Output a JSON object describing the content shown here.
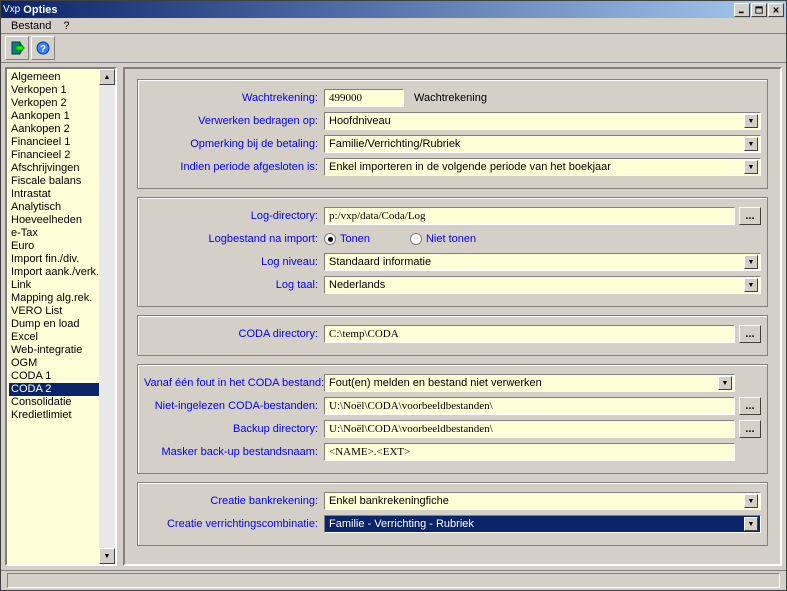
{
  "titlebar": {
    "vxp": "Vxp",
    "title": "Opties"
  },
  "menu": {
    "bestand": "Bestand",
    "help": "?"
  },
  "sidebar": {
    "items": [
      "Algemeen",
      "Verkopen 1",
      "Verkopen 2",
      "Aankopen 1",
      "Aankopen 2",
      "Financieel 1",
      "Financieel 2",
      "Afschrijvingen",
      "Fiscale balans",
      "Intrastat",
      "Analytisch",
      "Hoeveelheden",
      "e-Tax",
      "Euro",
      "Import fin./div.",
      "Import aank./verk.",
      "Link",
      "Mapping alg.rek.",
      "VERO List",
      "Dump en load",
      "Excel",
      "Web-integratie",
      "OGM",
      "CODA 1",
      "CODA 2",
      "Consolidatie",
      "Kredietlimiet"
    ],
    "selected": "CODA 2"
  },
  "group1": {
    "wachtrekening_label": "Wachtrekening:",
    "wachtrekening_value": "499000",
    "wachtrekening_side": "Wachtrekening",
    "verwerken_label": "Verwerken bedragen op:",
    "verwerken_value": "Hoofdniveau",
    "opmerking_label": "Opmerking bij de betaling:",
    "opmerking_value": "Familie/Verrichting/Rubriek",
    "periode_label": "Indien periode afgesloten is:",
    "periode_value": "Enkel importeren in de volgende periode van het boekjaar"
  },
  "group2": {
    "logdir_label": "Log-directory:",
    "logdir_value": "p:/vxp/data/Coda/Log",
    "logbestand_label": "Logbestand na import:",
    "radio_tonen": "Tonen",
    "radio_niettonen": "Niet tonen",
    "logniveau_label": "Log niveau:",
    "logniveau_value": "Standaard informatie",
    "logtaal_label": "Log taal:",
    "logtaal_value": "Nederlands"
  },
  "group3": {
    "codadir_label": "CODA directory:",
    "codadir_value": "C:\\temp\\CODA"
  },
  "group4": {
    "fout_label": "Vanaf één fout in het CODA bestand:",
    "fout_value": "Fout(en) melden en bestand niet verwerken",
    "nieting_label": "Niet-ingelezen CODA-bestanden:",
    "nieting_value": "U:\\Noël\\CODA\\voorbeeldbestanden\\",
    "backup_label": "Backup directory:",
    "backup_value": "U:\\Noël\\CODA\\voorbeeldbestanden\\",
    "masker_label": "Masker back-up bestandsnaam:",
    "masker_value": "<NAME>.<EXT>"
  },
  "group5": {
    "creatiebank_label": "Creatie bankrekening:",
    "creatiebank_value": "Enkel bankrekeningfiche",
    "creatiever_label": "Creatie verrichtingscombinatie:",
    "creatiever_value": "Familie - Verrichting - Rubriek"
  },
  "buttons": {
    "browse": "..."
  }
}
